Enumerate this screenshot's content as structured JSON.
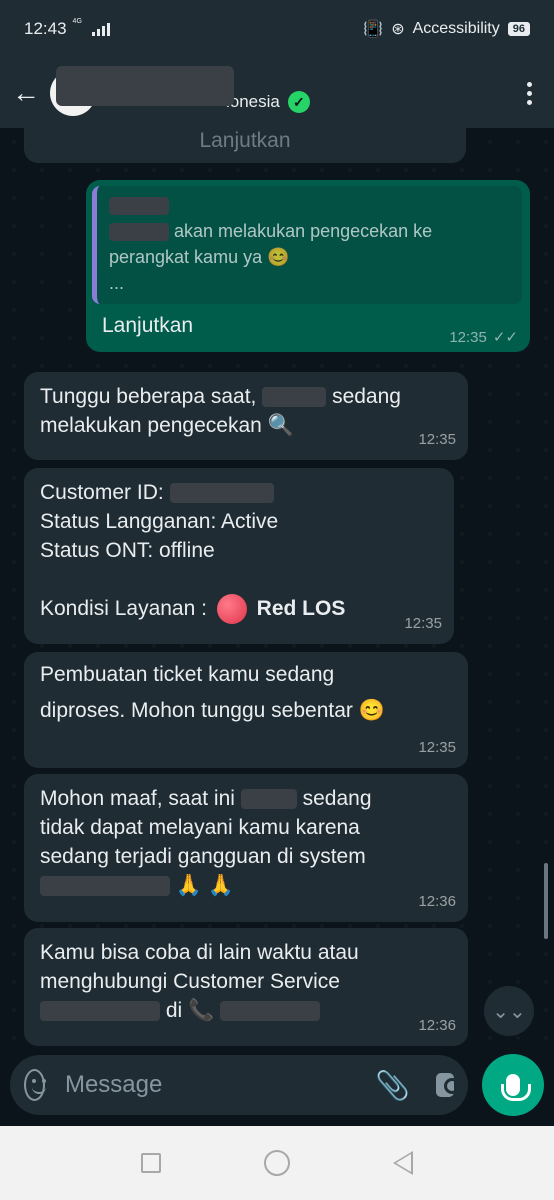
{
  "status_bar": {
    "time": "12:43",
    "network": "4G",
    "accessibility_label": "Accessibility",
    "battery": "96"
  },
  "header": {
    "contact_name_visible": "lonesia"
  },
  "messages": {
    "prev_partial": {
      "button_label": "Lanjutkan"
    },
    "out1": {
      "quote_text": "akan melakukan pengecekan ke perangkat kamu ya 😊",
      "quote_ellipsis": "...",
      "button_label": "Lanjutkan",
      "time": "12:35"
    },
    "in1": {
      "text_a": "Tunggu beberapa saat,",
      "text_b": "sedang",
      "text_c": "melakukan pengecekan 🔍",
      "time": "12:35"
    },
    "in2": {
      "customer_id_label": "Customer ID:",
      "status_langganan": "Status Langganan: Active",
      "status_ont": "Status ONT: offline",
      "kondisi_label": "Kondisi Layanan :",
      "kondisi_value": "Red LOS",
      "time": "12:35"
    },
    "in3": {
      "line1": "Pembuatan ticket kamu sedang",
      "line2": "diproses. Mohon tunggu sebentar 😊",
      "time": "12:35"
    },
    "in4": {
      "line1a": "Mohon maaf, saat ini",
      "line1b": "sedang",
      "line2": "tidak dapat melayani kamu karena",
      "line3": "sedang terjadi gangguan di system",
      "line4": "🙏 🙏",
      "time": "12:36"
    },
    "in5": {
      "line1": "Kamu bisa coba di lain waktu atau",
      "line2": "menghubungi Customer Service",
      "line3": "di 📞",
      "time": "12:36"
    }
  },
  "input": {
    "placeholder": "Message"
  },
  "colors": {
    "bg": "#0b141a",
    "bubble_in": "#202c33",
    "bubble_out": "#005c4b",
    "accent": "#00a884"
  }
}
